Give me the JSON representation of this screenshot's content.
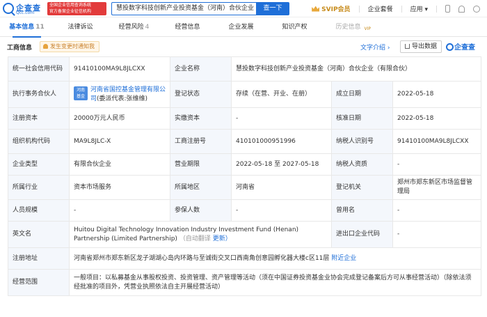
{
  "header": {
    "logo_text": "企查查",
    "logo_sub": "Qcc.com",
    "badge_line1": "全国企业信用查询系统",
    "badge_line2": "官方备案企业征信机构",
    "search_value": "慧投数字科技创新产业投资基金（河南）合伙企业",
    "search_button": "查一下",
    "svip": "SVIP会员",
    "suite": "企业套餐",
    "apps": "应用",
    "apps_caret": "▾"
  },
  "nav": {
    "tabs": [
      {
        "label": "基本信息",
        "count": "11"
      },
      {
        "label": "法律诉讼",
        "count": ""
      },
      {
        "label": "经营风险",
        "count": "4"
      },
      {
        "label": "经营信息",
        "count": ""
      },
      {
        "label": "企业发展",
        "count": ""
      },
      {
        "label": "知识产权",
        "count": ""
      },
      {
        "label": "历史信息",
        "count": "",
        "tag": "VIP"
      }
    ]
  },
  "section": {
    "title": "工商信息",
    "notify": "发生变更时通知我",
    "intro": "文字介绍 ›",
    "export": "导出数据",
    "brand": "企查查"
  },
  "table": {
    "credit_code_label": "统一社会信用代码",
    "credit_code": "91410100MA9L8JLCXX",
    "company_name_label": "企业名称",
    "company_name": "慧投数字科技创新产业投资基金（河南）合伙企业（有限合伙）",
    "partner_label": "执行事务合伙人",
    "partner_logo": "河南省国控基金",
    "partner_logo_l1": "河南",
    "partner_logo_l2": "基金",
    "partner_name": "河南省国控基金管理有限公司",
    "partner_rep": "(委派代表:张维维)",
    "reg_status_label": "登记状态",
    "reg_status": "存续（在营、开业、在册）",
    "est_date_label": "成立日期",
    "est_date": "2022-05-18",
    "capital_label": "注册资本",
    "capital": "20000万元人民币",
    "paid_capital_label": "实缴资本",
    "paid_capital": "-",
    "approve_date_label": "核准日期",
    "approve_date": "2022-05-18",
    "org_code_label": "组织机构代码",
    "org_code": "MA9L8JLC-X",
    "biz_reg_label": "工商注册号",
    "biz_reg": "410101000951996",
    "taxpayer_label": "纳税人识别号",
    "taxpayer": "91410100MA9L8JLCXX",
    "type_label": "企业类型",
    "type": "有限合伙企业",
    "term_label": "营业期限",
    "term": "2022-05-18 至 2027-05-18",
    "tax_quality_label": "纳税人资质",
    "tax_quality": "-",
    "industry_label": "所属行业",
    "industry": "资本市场服务",
    "region_label": "所属地区",
    "region": "河南省",
    "authority_label": "登记机关",
    "authority": "郑州市郑东新区市场监督管理局",
    "staff_label": "人员规模",
    "staff": "-",
    "insured_label": "参保人数",
    "insured": "-",
    "former_name_label": "曾用名",
    "former_name": "-",
    "english_label": "英文名",
    "english": "Huitou Digital Technology Innovation Industry Investment Fund (Henan) Partnership (Limited Partnership)",
    "english_auto": "（自动翻译",
    "english_update": "更新）",
    "import_export_label": "进出口企业代码",
    "import_export": "-",
    "address_label": "注册地址",
    "address": "河南省郑州市郑东新区龙子湖湖心岛内环路与至诚街交叉口西南角创意园孵化器大楼c区11层",
    "nearby": "附近企业",
    "scope_label": "经营范围",
    "scope": "一般项目：以私募基金从事股权投资、投资管理、资产管理等活动（须在中国证券投资基金业协会完成登记备案后方可从事经营活动）（除依法须经批准的项目外，凭营业执照依法自主开展经营活动）"
  }
}
